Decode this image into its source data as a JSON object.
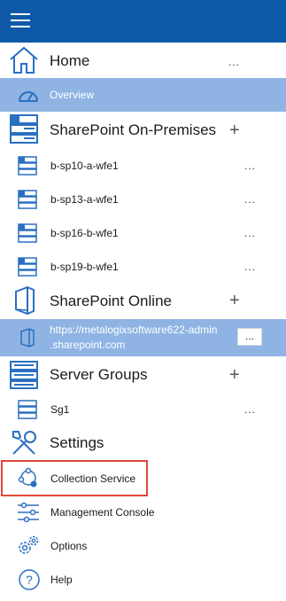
{
  "topbar": {
    "menu_icon": "hamburger-icon"
  },
  "nav": {
    "home": {
      "label": "Home",
      "icon": "home-icon",
      "more": "..."
    },
    "overview": {
      "label": "Overview",
      "icon": "speedometer-icon"
    },
    "sp_onprem": {
      "label": "SharePoint On-Premises",
      "icon": "server-stack-icon",
      "add": "+",
      "servers": [
        {
          "label": "b-sp10-a-wfe1",
          "more": "..."
        },
        {
          "label": "b-sp13-a-wfe1",
          "more": "..."
        },
        {
          "label": "b-sp16-b-wfe1",
          "more": "..."
        },
        {
          "label": "b-sp19-b-wfe1",
          "more": "..."
        }
      ]
    },
    "sp_online": {
      "label": "SharePoint Online",
      "icon": "office-icon",
      "add": "+",
      "tenant": {
        "line1": "https://metalogixsoftware622-admin",
        "line2": ".sharepoint.com",
        "more": "..."
      }
    },
    "server_groups": {
      "label": "Server Groups",
      "icon": "server-group-icon",
      "add": "+",
      "groups": [
        {
          "label": "Sg1",
          "more": "..."
        }
      ]
    },
    "settings": {
      "label": "Settings",
      "icon": "tools-icon",
      "items": [
        {
          "label": "Collection Service",
          "icon": "collection-service-icon"
        },
        {
          "label": "Management Console",
          "icon": "sliders-icon"
        },
        {
          "label": "Options",
          "icon": "gears-icon"
        },
        {
          "label": "Help",
          "icon": "help-icon"
        }
      ]
    }
  },
  "colors": {
    "topbar": "#0f5aa8",
    "selected_bg": "#8fb4e3",
    "highlight_border": "#e0483b",
    "icon_blue": "#2a6fc2"
  }
}
